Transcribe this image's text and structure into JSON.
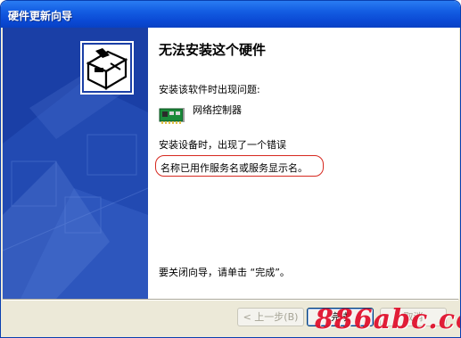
{
  "window": {
    "title": "硬件更新向导"
  },
  "content": {
    "heading": "无法安装这个硬件",
    "problem_text": "安装该软件时出现问题:",
    "device_name": "网络控制器",
    "error_text": "安装设备时，出现了一个错误",
    "error_detail": "名称已用作服务名或服务显示名。",
    "close_text": "要关闭向导，请单击 “完成”。"
  },
  "buttons": {
    "back": "< 上一步(B)",
    "finish": "完成",
    "cancel": "取消"
  },
  "watermark": "886abc.com",
  "icons": {
    "wizard": "hardware-box-icon",
    "device": "network-card-icon"
  },
  "colors": {
    "titlebar": "#0a49d4",
    "side_panel": "#1a3fa6",
    "highlight_ring": "#d6281f",
    "watermark": "#e0122e"
  }
}
